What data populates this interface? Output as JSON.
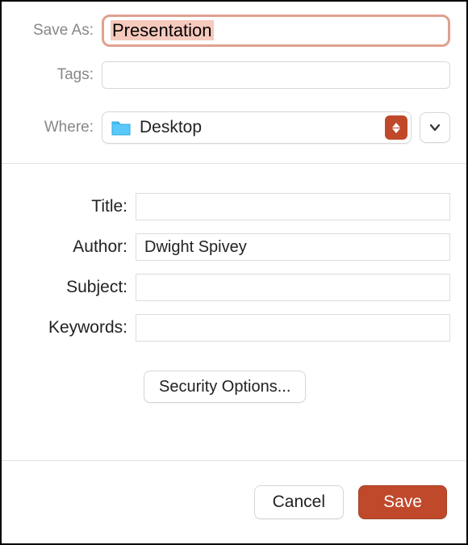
{
  "top": {
    "saveAsLabel": "Save As:",
    "saveAsValue": "Presentation",
    "tagsLabel": "Tags:",
    "tagsValue": "",
    "whereLabel": "Where:",
    "whereValue": "Desktop"
  },
  "meta": {
    "titleLabel": "Title:",
    "titleValue": "",
    "authorLabel": "Author:",
    "authorValue": "Dwight Spivey",
    "subjectLabel": "Subject:",
    "subjectValue": "",
    "keywordsLabel": "Keywords:",
    "keywordsValue": "",
    "securityOptionsLabel": "Security Options..."
  },
  "footer": {
    "cancelLabel": "Cancel",
    "saveLabel": "Save"
  },
  "colors": {
    "accent": "#c0492b",
    "highlightBorder": "#dfa18f",
    "highlightFill": "#f6c9bd"
  }
}
